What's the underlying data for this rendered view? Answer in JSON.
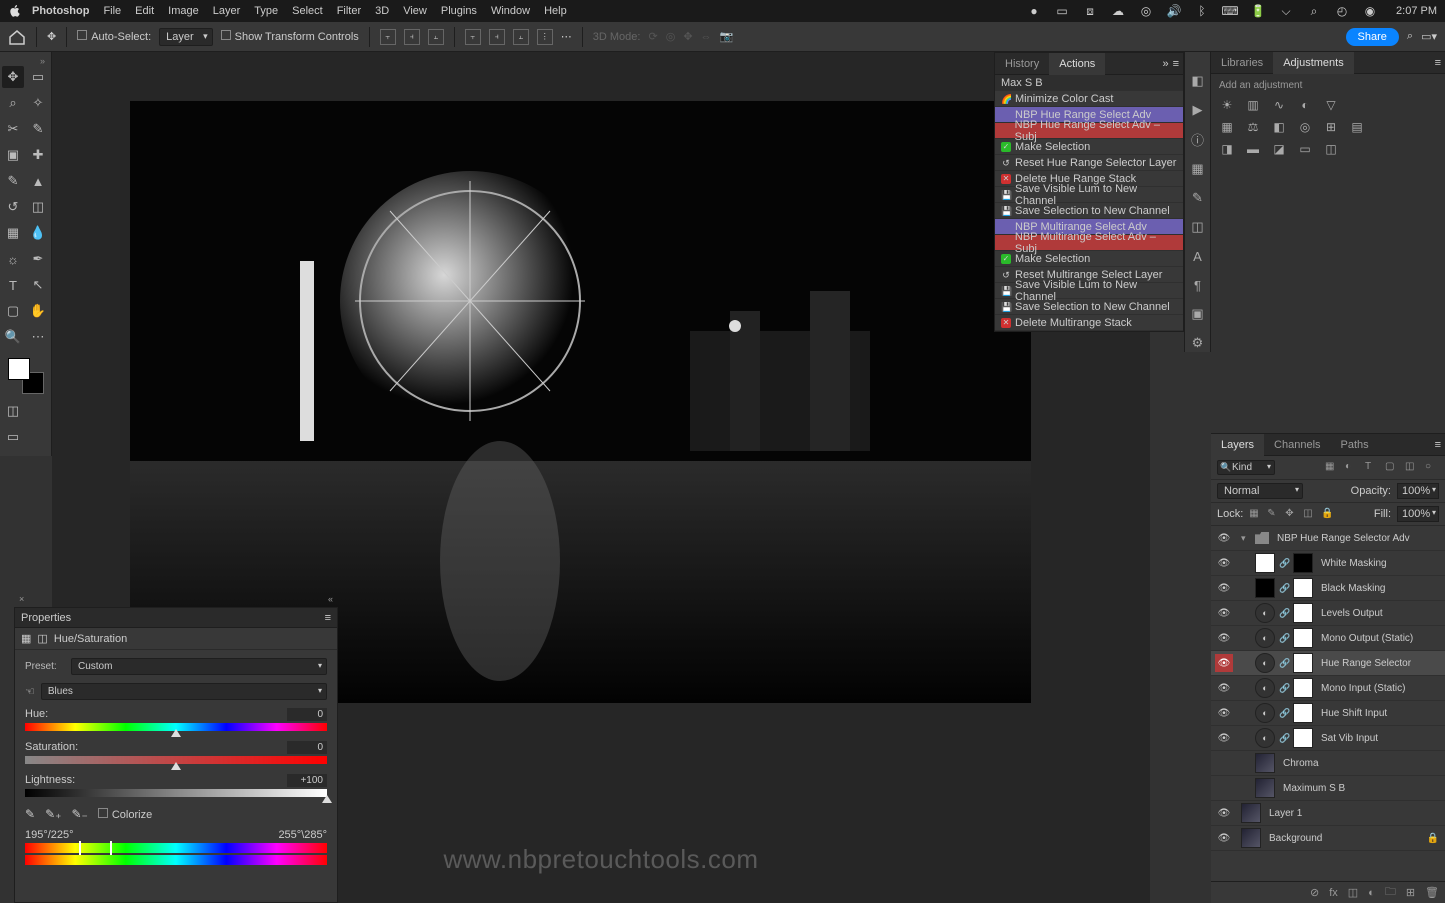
{
  "menubar": {
    "app": "Photoshop",
    "items": [
      "File",
      "Edit",
      "Image",
      "Layer",
      "Type",
      "Select",
      "Filter",
      "3D",
      "View",
      "Plugins",
      "Window",
      "Help"
    ],
    "clock": "2:07 PM"
  },
  "options": {
    "auto_select": "Auto-Select:",
    "layer_target": "Layer",
    "show_transform": "Show Transform Controls",
    "mode_3d": "3D Mode:",
    "share": "Share"
  },
  "actions_panel": {
    "tab_history": "History",
    "tab_actions": "Actions",
    "header": "Max S B",
    "items": [
      {
        "icon": "rainbow",
        "label": "Minimize Color Cast",
        "cls": ""
      },
      {
        "icon": "",
        "label": "NBP Hue Range Select Adv",
        "cls": "purple"
      },
      {
        "icon": "",
        "label": "NBP Hue Range Select Adv – Subj",
        "cls": "red"
      },
      {
        "icon": "chk",
        "label": "Make Selection",
        "cls": ""
      },
      {
        "icon": "reset",
        "label": "Reset Hue Range Selector Layer",
        "cls": ""
      },
      {
        "icon": "x",
        "label": "Delete Hue Range Stack",
        "cls": ""
      },
      {
        "icon": "save",
        "label": "Save Visible Lum to New Channel",
        "cls": ""
      },
      {
        "icon": "save",
        "label": "Save Selection to New Channel",
        "cls": ""
      },
      {
        "icon": "",
        "label": "NBP Multirange Select Adv",
        "cls": "purple"
      },
      {
        "icon": "",
        "label": "NBP Multirange Select Adv – Subj",
        "cls": "red"
      },
      {
        "icon": "chk",
        "label": "Make Selection",
        "cls": ""
      },
      {
        "icon": "reset",
        "label": "Reset Multirange Select Layer",
        "cls": ""
      },
      {
        "icon": "save",
        "label": "Save Visible Lum to New Channel",
        "cls": ""
      },
      {
        "icon": "save",
        "label": "Save Selection to New Channel",
        "cls": ""
      },
      {
        "icon": "x",
        "label": "Delete Multirange Stack",
        "cls": ""
      }
    ]
  },
  "adjustments": {
    "tab_libraries": "Libraries",
    "tab_adjustments": "Adjustments",
    "add_label": "Add an adjustment"
  },
  "layers": {
    "tab_layers": "Layers",
    "tab_channels": "Channels",
    "tab_paths": "Paths",
    "kind": "Kind",
    "blend_mode": "Normal",
    "opacity_label": "Opacity:",
    "opacity": "100%",
    "lock_label": "Lock:",
    "fill_label": "Fill:",
    "fill": "100%",
    "items": [
      {
        "type": "group",
        "name": "NBP Hue Range Selector Adv",
        "eye": true,
        "open": true
      },
      {
        "type": "fill",
        "name": "White Masking",
        "eye": true,
        "thumb": "white",
        "mask": "black",
        "indent": 1
      },
      {
        "type": "fill",
        "name": "Black Masking",
        "eye": true,
        "thumb": "black",
        "mask": "white",
        "indent": 1
      },
      {
        "type": "adj",
        "name": "Levels Output",
        "eye": true,
        "mask": "white",
        "indent": 1
      },
      {
        "type": "adj",
        "name": "Mono Output (Static)",
        "eye": true,
        "mask": "white",
        "indent": 1
      },
      {
        "type": "adj",
        "name": "Hue Range Selector",
        "eye": true,
        "mask": "white",
        "indent": 1,
        "sel": true
      },
      {
        "type": "adj",
        "name": "Mono Input (Static)",
        "eye": true,
        "mask": "white",
        "indent": 1
      },
      {
        "type": "adj",
        "name": "Hue Shift Input",
        "eye": true,
        "mask": "white",
        "indent": 1
      },
      {
        "type": "adj",
        "name": "Sat Vib Input",
        "eye": true,
        "mask": "white",
        "indent": 1
      },
      {
        "type": "img",
        "name": "Chroma",
        "eye": false,
        "indent": 1,
        "small": true
      },
      {
        "type": "img",
        "name": "Maximum S B",
        "eye": false,
        "indent": 1,
        "small": true
      },
      {
        "type": "img",
        "name": "Layer 1",
        "eye": true,
        "indent": 0
      },
      {
        "type": "img",
        "name": "Background",
        "eye": true,
        "indent": 0,
        "locked": true
      }
    ]
  },
  "properties": {
    "title": "Properties",
    "type_label": "Hue/Saturation",
    "preset_label": "Preset:",
    "preset": "Custom",
    "channel": "Blues",
    "hue_label": "Hue:",
    "hue": "0",
    "sat_label": "Saturation:",
    "sat": "0",
    "light_label": "Lightness:",
    "light": "+100",
    "colorize": "Colorize",
    "range_left": "195°/225°",
    "range_right": "255°\\285°"
  },
  "watermark": "www.nbpretouchtools.com"
}
